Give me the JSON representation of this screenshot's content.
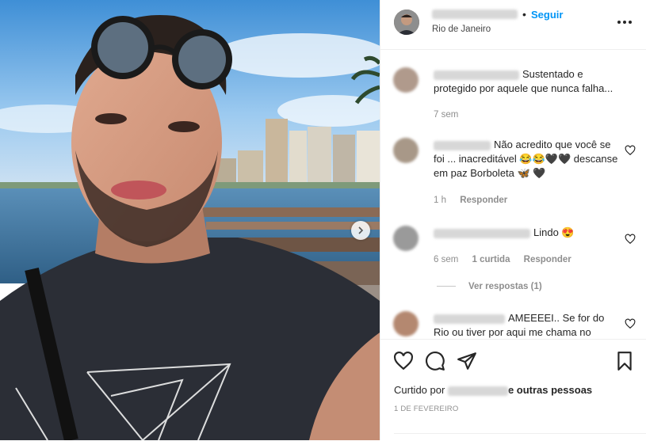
{
  "post": {
    "location": "Rio de Janeiro",
    "follow_label": "Seguir",
    "separator": "•"
  },
  "comments": [
    {
      "text": "Sustentado e protegido por aquele que nunca falha...",
      "time": "7 sem"
    },
    {
      "text": "Não acredito que você se foi ... inacreditável 😂😂🖤🖤 descanse em paz Borboleta 🦋 🖤",
      "time": "1 h",
      "reply": "Responder"
    },
    {
      "text": "Lindo 😍",
      "time": "6 sem",
      "likes": "1 curtida",
      "reply": "Responder",
      "view_replies": "Ver respostas (1)"
    },
    {
      "text": "AMEEEEI.. Se for do Rio ou tiver por aqui me chama no"
    }
  ],
  "likes": {
    "prefix": "Curtido por",
    "suffix": "e outras pessoas"
  },
  "date": "1 DE FEVEREIRO",
  "icons": {
    "more": "more-options-icon",
    "next": "chevron-right-icon",
    "like": "heart-icon",
    "comment": "comment-icon",
    "share": "paper-plane-icon",
    "save": "bookmark-icon"
  },
  "colors": {
    "accent": "#0095f6",
    "text": "#262626",
    "muted": "#8e8e8e"
  }
}
